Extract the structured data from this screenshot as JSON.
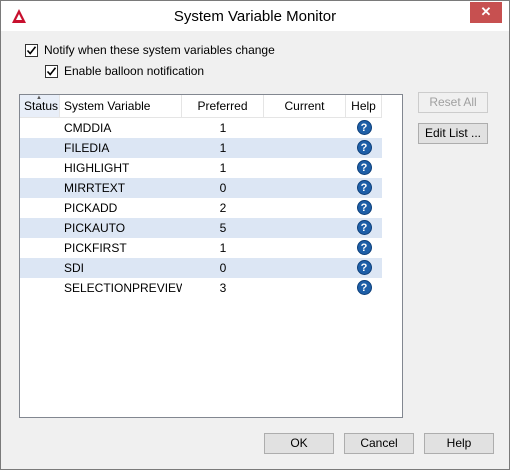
{
  "window": {
    "title": "System Variable Monitor",
    "close_glyph": "✕"
  },
  "options": {
    "notify_label": "Notify when these system variables change",
    "notify_checked": true,
    "balloon_label": "Enable balloon notification",
    "balloon_checked": true
  },
  "table": {
    "columns": {
      "status": "Status",
      "variable": "System Variable",
      "preferred": "Preferred",
      "current": "Current",
      "help": "Help"
    },
    "rows": [
      {
        "variable": "CMDDIA",
        "preferred": "1",
        "current": ""
      },
      {
        "variable": "FILEDIA",
        "preferred": "1",
        "current": ""
      },
      {
        "variable": "HIGHLIGHT",
        "preferred": "1",
        "current": ""
      },
      {
        "variable": "MIRRTEXT",
        "preferred": "0",
        "current": ""
      },
      {
        "variable": "PICKADD",
        "preferred": "2",
        "current": ""
      },
      {
        "variable": "PICKAUTO",
        "preferred": "5",
        "current": ""
      },
      {
        "variable": "PICKFIRST",
        "preferred": "1",
        "current": ""
      },
      {
        "variable": "SDI",
        "preferred": "0",
        "current": ""
      },
      {
        "variable": "SELECTIONPREVIEW",
        "preferred": "3",
        "current": ""
      }
    ],
    "help_glyph": "?"
  },
  "side_buttons": {
    "reset_all": "Reset All",
    "edit_list": "Edit List ..."
  },
  "footer": {
    "ok": "OK",
    "cancel": "Cancel",
    "help": "Help"
  }
}
